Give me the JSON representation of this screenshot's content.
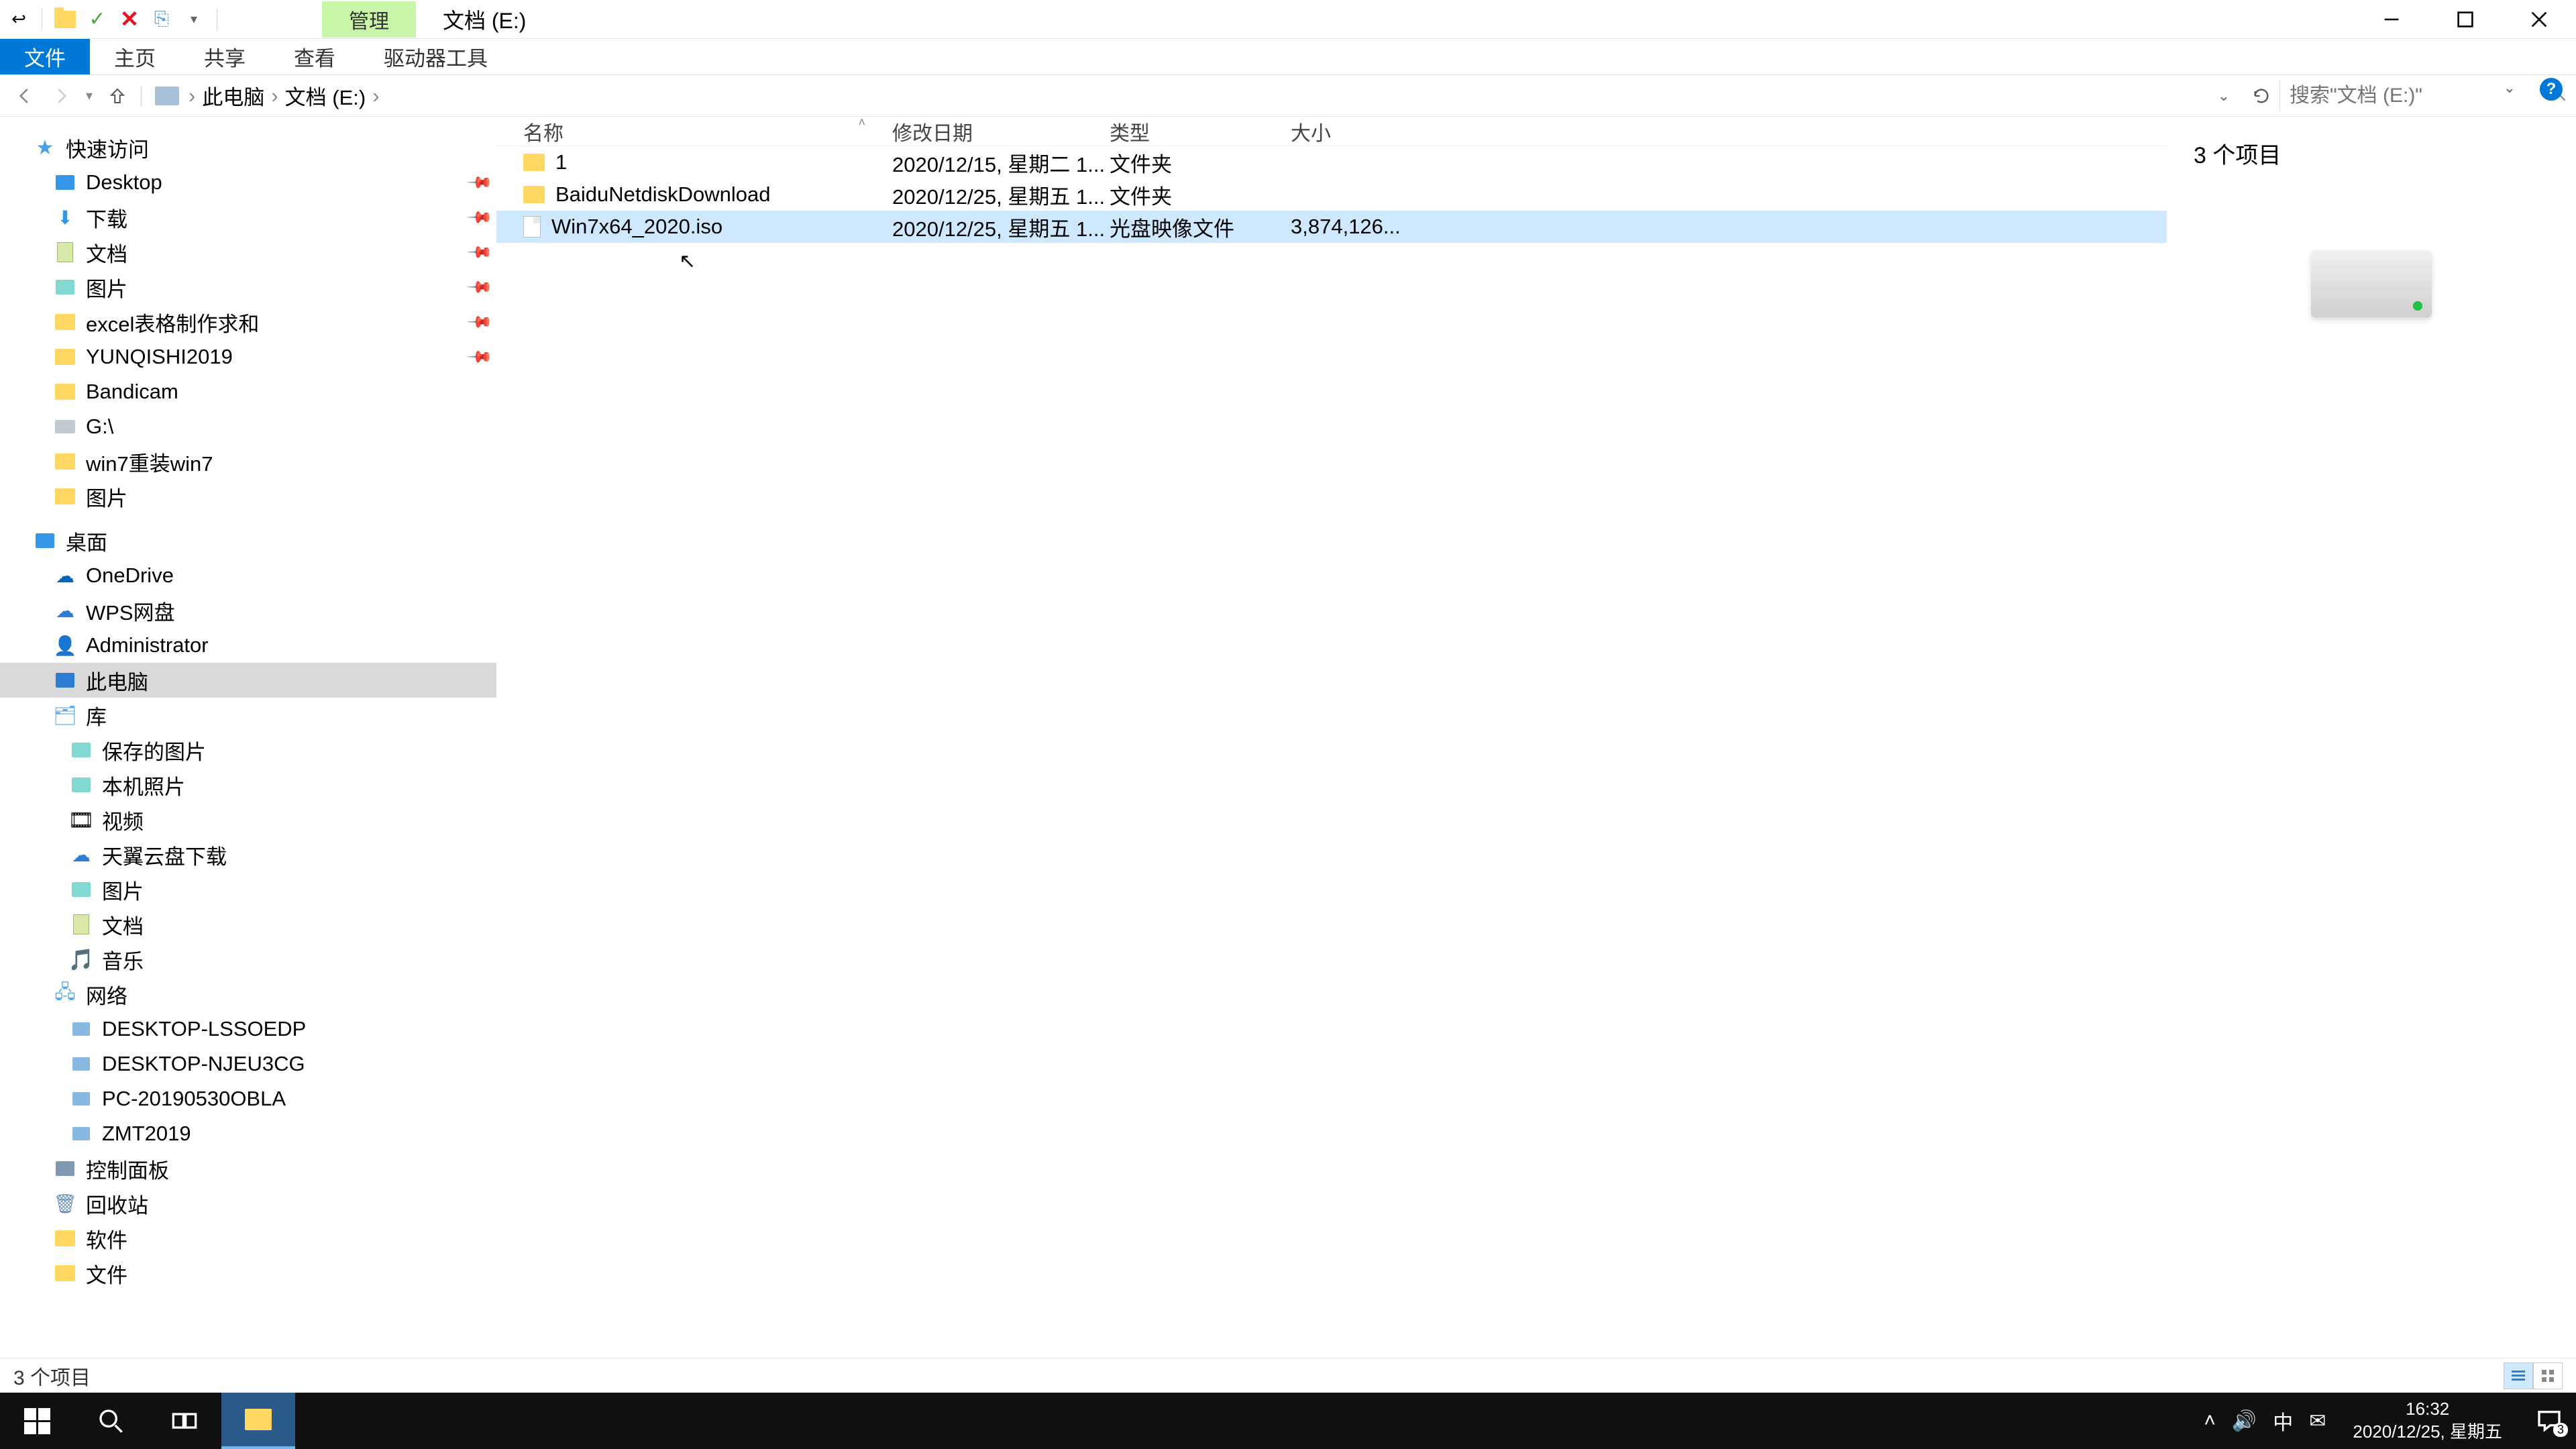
{
  "title": {
    "ribbon_context": "管理",
    "window_title": "文档 (E:)"
  },
  "ribbon": {
    "file": "文件",
    "home": "主页",
    "share": "共享",
    "view": "查看",
    "drive_tools": "驱动器工具"
  },
  "breadcrumb": {
    "root": "此电脑",
    "drive": "文档 (E:)"
  },
  "search": {
    "placeholder": "搜索\"文档 (E:)\""
  },
  "columns": {
    "name": "名称",
    "date": "修改日期",
    "type": "类型",
    "size": "大小"
  },
  "files": [
    {
      "name": "1",
      "date": "2020/12/15, 星期二 1...",
      "type": "文件夹",
      "size": "",
      "icon": "folder",
      "selected": false
    },
    {
      "name": "BaiduNetdiskDownload",
      "date": "2020/12/25, 星期五 1...",
      "type": "文件夹",
      "size": "",
      "icon": "folder",
      "selected": false
    },
    {
      "name": "Win7x64_2020.iso",
      "date": "2020/12/25, 星期五 1...",
      "type": "光盘映像文件",
      "size": "3,874,126...",
      "icon": "iso",
      "selected": true
    }
  ],
  "preview": {
    "item_count": "3 个项目"
  },
  "nav": {
    "quick_access": "快速访问",
    "desktop": "Desktop",
    "downloads": "下载",
    "documents": "文档",
    "pictures": "图片",
    "excel": "excel表格制作求和",
    "yunqishi": "YUNQISHI2019",
    "bandicam": "Bandicam",
    "gdrive": "G:\\",
    "win7reinstall": "win7重装win7",
    "pictures2": "图片",
    "desktop2": "桌面",
    "onedrive": "OneDrive",
    "wps": "WPS网盘",
    "admin": "Administrator",
    "thispc": "此电脑",
    "libraries": "库",
    "saved_pics": "保存的图片",
    "camera_roll": "本机照片",
    "videos": "视频",
    "tianyi": "天翼云盘下载",
    "lib_pics": "图片",
    "lib_docs": "文档",
    "music": "音乐",
    "network": "网络",
    "net1": "DESKTOP-LSSOEDP",
    "net2": "DESKTOP-NJEU3CG",
    "net3": "PC-20190530OBLA",
    "net4": "ZMT2019",
    "control_panel": "控制面板",
    "recycle": "回收站",
    "software": "软件",
    "files_folder": "文件"
  },
  "status": {
    "items": "3 个项目"
  },
  "tray": {
    "ime": "中",
    "time": "16:32",
    "date": "2020/12/25, 星期五",
    "notif_count": "3"
  }
}
